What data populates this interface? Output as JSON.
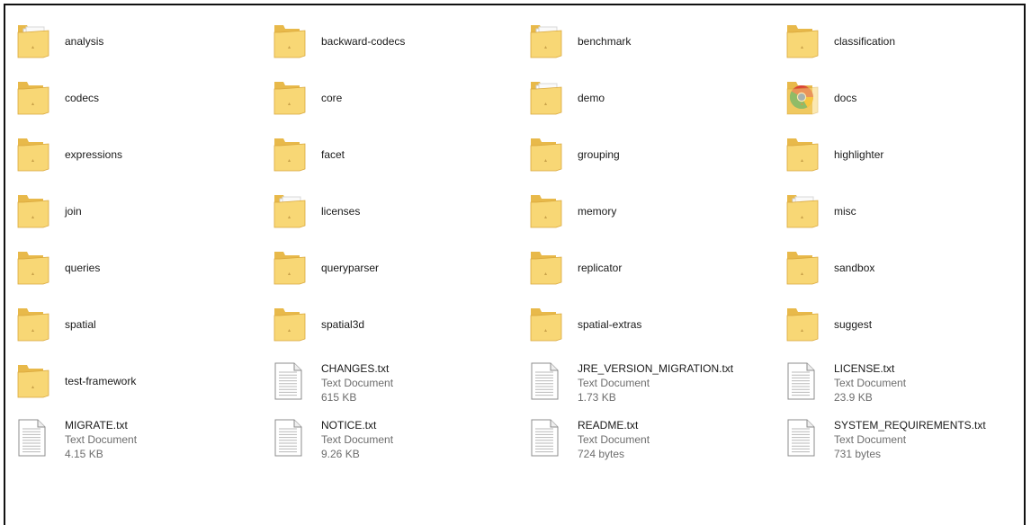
{
  "items": [
    {
      "name": "analysis",
      "kind": "folder",
      "icon": "folder-with-pages-icon"
    },
    {
      "name": "backward-codecs",
      "kind": "folder",
      "icon": "folder-icon"
    },
    {
      "name": "benchmark",
      "kind": "folder",
      "icon": "folder-with-pages-icon"
    },
    {
      "name": "classification",
      "kind": "folder",
      "icon": "folder-icon"
    },
    {
      "name": "codecs",
      "kind": "folder",
      "icon": "folder-icon"
    },
    {
      "name": "core",
      "kind": "folder",
      "icon": "folder-icon"
    },
    {
      "name": "demo",
      "kind": "folder",
      "icon": "folder-with-pages-icon"
    },
    {
      "name": "docs",
      "kind": "folder",
      "icon": "folder-chrome-icon"
    },
    {
      "name": "expressions",
      "kind": "folder",
      "icon": "folder-icon"
    },
    {
      "name": "facet",
      "kind": "folder",
      "icon": "folder-icon"
    },
    {
      "name": "grouping",
      "kind": "folder",
      "icon": "folder-icon"
    },
    {
      "name": "highlighter",
      "kind": "folder",
      "icon": "folder-icon"
    },
    {
      "name": "join",
      "kind": "folder",
      "icon": "folder-icon"
    },
    {
      "name": "licenses",
      "kind": "folder",
      "icon": "folder-with-pages-icon"
    },
    {
      "name": "memory",
      "kind": "folder",
      "icon": "folder-icon"
    },
    {
      "name": "misc",
      "kind": "folder",
      "icon": "folder-with-pages-icon"
    },
    {
      "name": "queries",
      "kind": "folder",
      "icon": "folder-icon"
    },
    {
      "name": "queryparser",
      "kind": "folder",
      "icon": "folder-icon"
    },
    {
      "name": "replicator",
      "kind": "folder",
      "icon": "folder-icon"
    },
    {
      "name": "sandbox",
      "kind": "folder",
      "icon": "folder-icon"
    },
    {
      "name": "spatial",
      "kind": "folder",
      "icon": "folder-icon"
    },
    {
      "name": "spatial3d",
      "kind": "folder",
      "icon": "folder-icon"
    },
    {
      "name": "spatial-extras",
      "kind": "folder",
      "icon": "folder-icon"
    },
    {
      "name": "suggest",
      "kind": "folder",
      "icon": "folder-icon"
    },
    {
      "name": "test-framework",
      "kind": "folder",
      "icon": "folder-icon"
    },
    {
      "name": "CHANGES.txt",
      "kind": "file",
      "icon": "text-document-icon",
      "type": "Text Document",
      "size": "615 KB"
    },
    {
      "name": "JRE_VERSION_MIGRATION.txt",
      "kind": "file",
      "icon": "text-document-icon",
      "type": "Text Document",
      "size": "1.73 KB"
    },
    {
      "name": "LICENSE.txt",
      "kind": "file",
      "icon": "text-document-icon",
      "type": "Text Document",
      "size": "23.9 KB"
    },
    {
      "name": "MIGRATE.txt",
      "kind": "file",
      "icon": "text-document-icon",
      "type": "Text Document",
      "size": "4.15 KB"
    },
    {
      "name": "NOTICE.txt",
      "kind": "file",
      "icon": "text-document-icon",
      "type": "Text Document",
      "size": "9.26 KB"
    },
    {
      "name": "README.txt",
      "kind": "file",
      "icon": "text-document-icon",
      "type": "Text Document",
      "size": "724 bytes"
    },
    {
      "name": "SYSTEM_REQUIREMENTS.txt",
      "kind": "file",
      "icon": "text-document-icon",
      "type": "Text Document",
      "size": "731 bytes"
    }
  ],
  "colors": {
    "folder_back": "#e8b94a",
    "folder_front": "#f8d775",
    "folder_edge": "#d9a73c",
    "text_secondary": "#6d6d6d"
  }
}
